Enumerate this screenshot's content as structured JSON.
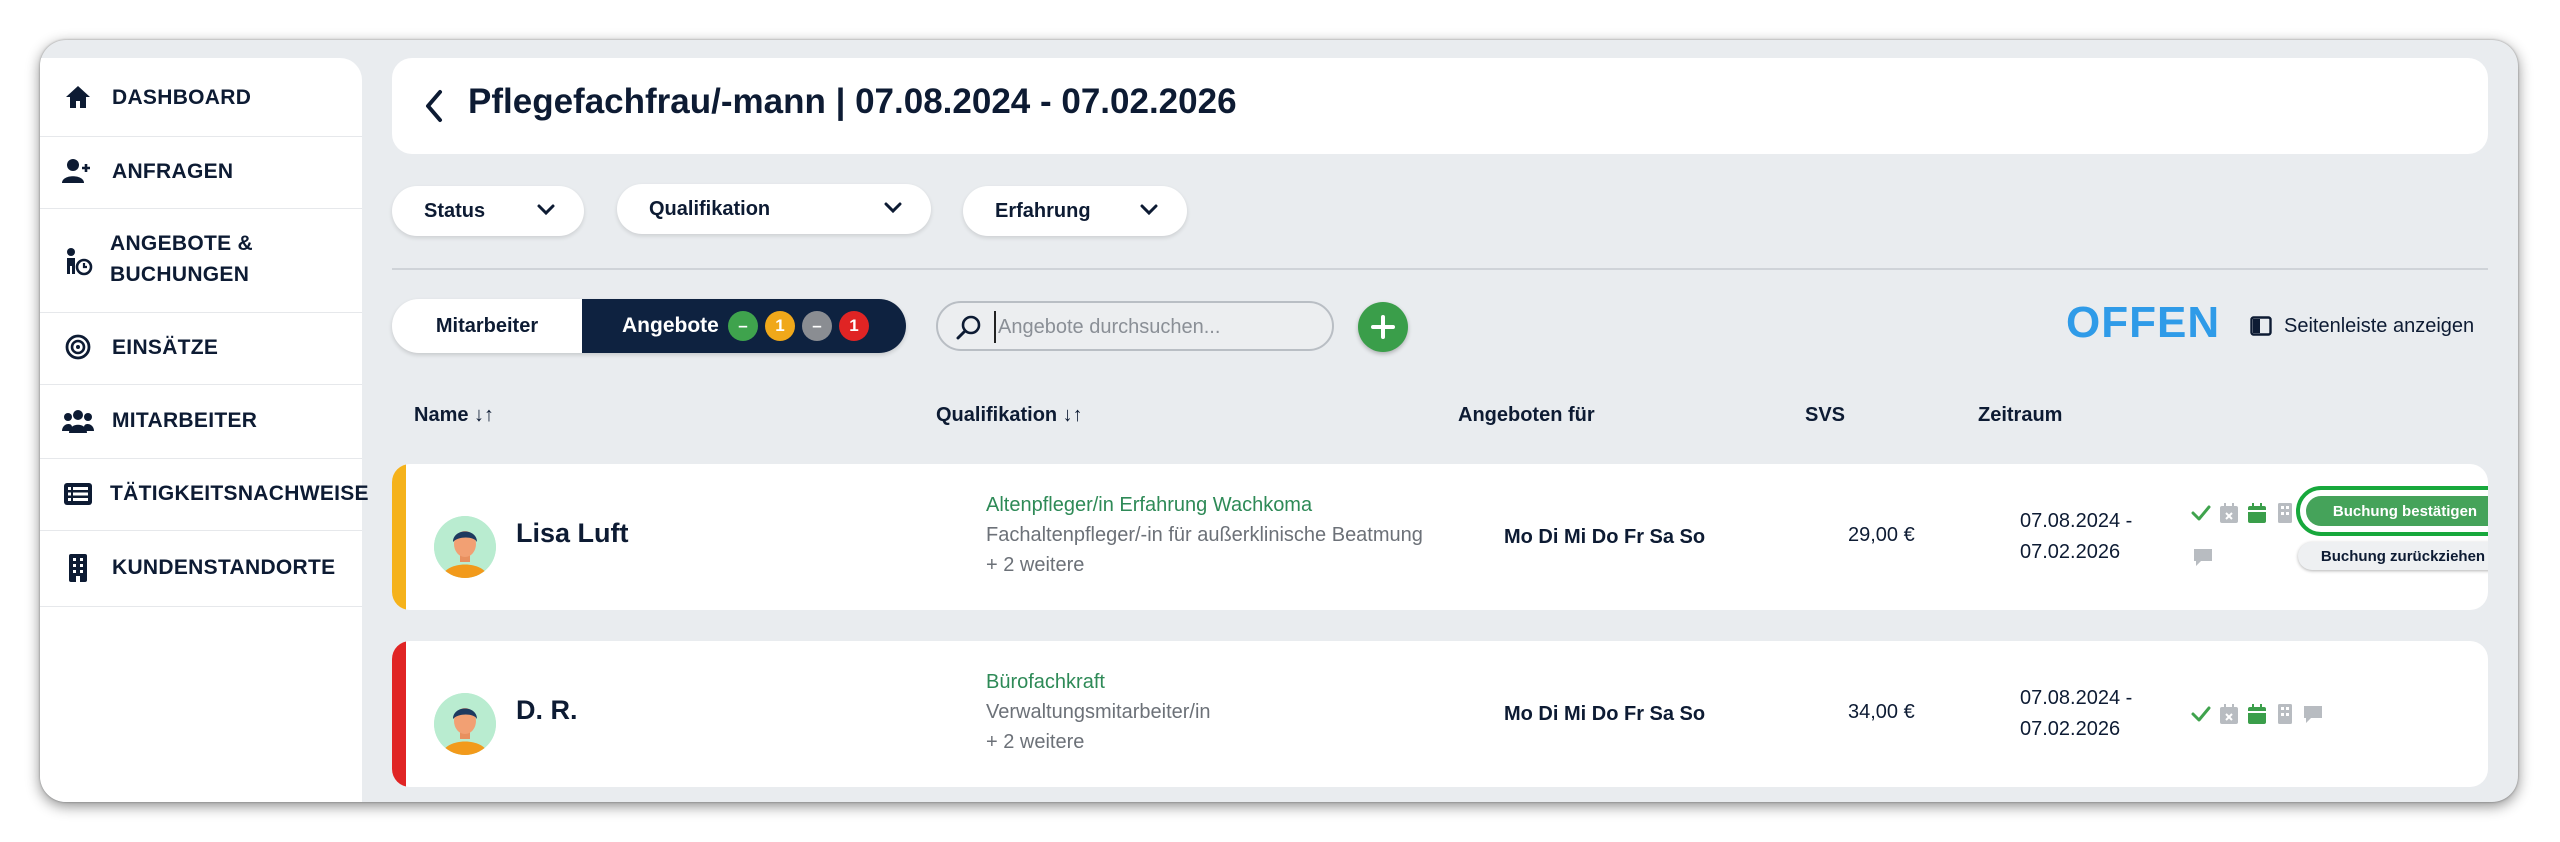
{
  "sidebar": {
    "items": [
      {
        "label": "DASHBOARD",
        "icon": "home-icon"
      },
      {
        "label": "ANFRAGEN",
        "icon": "add-user-icon"
      },
      {
        "label_line1": "ANGEBOTE &",
        "label_line2": "BUCHUNGEN",
        "icon": "offers-bookings-icon"
      },
      {
        "label": "EINSÄTZE",
        "icon": "target-icon"
      },
      {
        "label": "MITARBEITER",
        "icon": "users-icon"
      },
      {
        "label": "TÄTIGKEITSNACHWEISE",
        "icon": "list-icon"
      },
      {
        "label": "KUNDENSTANDORTE",
        "icon": "building-icon"
      }
    ]
  },
  "header": {
    "title": "Pflegefachfrau/-mann | 07.08.2024 - 07.02.2026"
  },
  "filters": [
    {
      "label": "Status"
    },
    {
      "label": "Qualifikation"
    },
    {
      "label": "Erfahrung"
    }
  ],
  "toggle": {
    "left_label": "Mitarbeiter",
    "right_label": "Angebote",
    "badges": [
      {
        "text": "–",
        "color": "#3fa34d"
      },
      {
        "text": "1",
        "color": "#f0a81a"
      },
      {
        "text": "–",
        "color": "#8a8d92"
      },
      {
        "text": "1",
        "color": "#e02424"
      }
    ]
  },
  "search": {
    "placeholder": "Angebote durchsuchen..."
  },
  "status_text": "OFFEN",
  "sidebar_toggle_label": "Seitenleiste anzeigen",
  "columns": {
    "name": "Name ↓↑",
    "qualifikation": "Qualifikation ↓↑",
    "angeboten": "Angeboten für",
    "svs": "SVS",
    "zeitraum": "Zeitraum"
  },
  "rows": [
    {
      "accent_color": "#f5b21b",
      "name": "Lisa Luft",
      "qual_primary": "Altenpfleger/in Erfahrung Wachkoma",
      "qual_secondary": "Fachaltenpfleger/-in für außerklinische Beatmung",
      "qual_more": "+ 2 weitere",
      "days": "Mo Di Mi Do Fr Sa So",
      "svs": "29,00 €",
      "zeitraum_start": "07.08.2024 -",
      "zeitraum_end": "07.02.2026",
      "confirm_label": "Buchung bestätigen",
      "withdraw_label": "Buchung zurückziehen"
    },
    {
      "accent_color": "#e02424",
      "name": "D. R.",
      "qual_primary": "Bürofachkraft",
      "qual_secondary": "Verwaltungsmitarbeiter/in",
      "qual_more": "+ 2 weitere",
      "days": "Mo Di Mi Do Fr Sa So",
      "svs": "34,00 €",
      "zeitraum_start": "07.08.2024 -",
      "zeitraum_end": "07.02.2026"
    }
  ],
  "colors": {
    "navy": "#0e2240",
    "green": "#3a9e4a",
    "open_blue": "#2f9be8",
    "qual_green": "#2e8a57"
  }
}
